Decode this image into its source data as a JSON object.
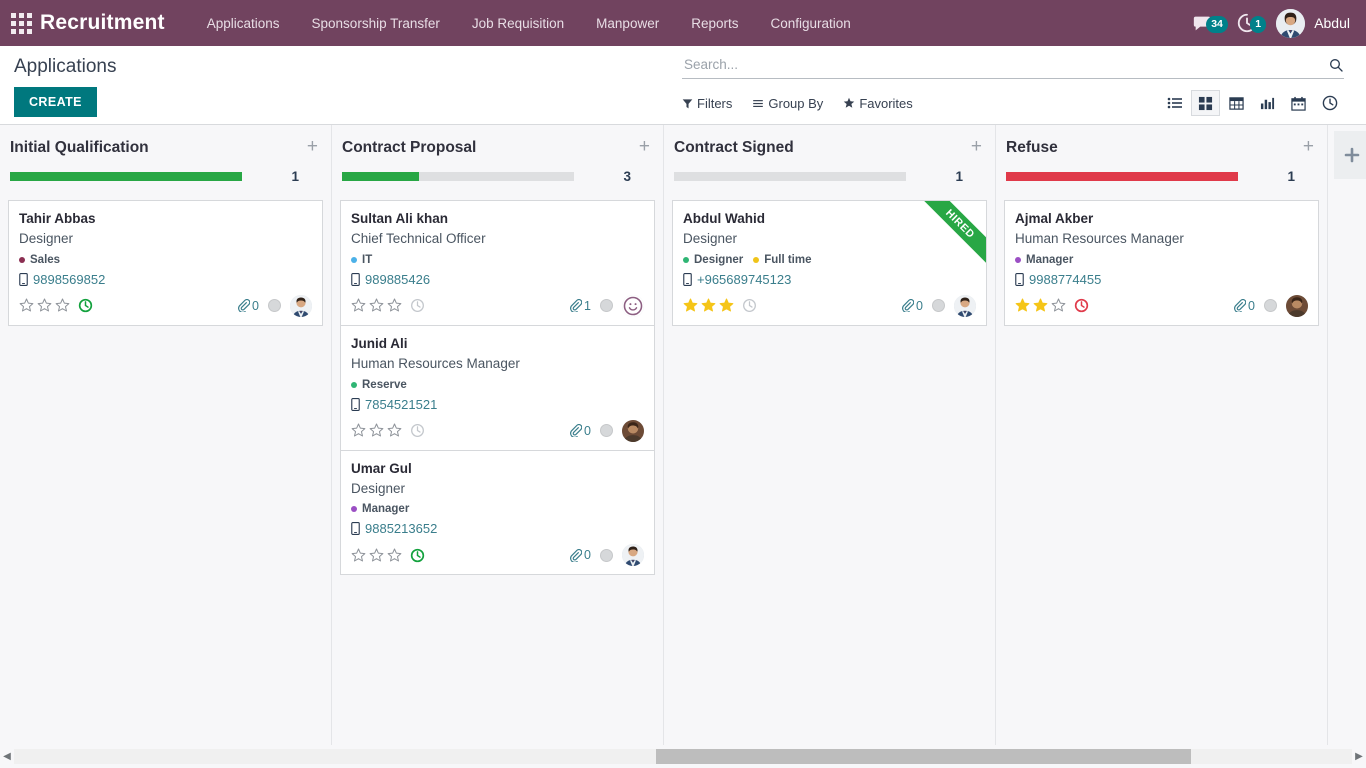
{
  "topbar": {
    "apps_icon": "apps-grid-icon",
    "brand": "Recruitment",
    "nav": [
      {
        "label": "Applications"
      },
      {
        "label": "Sponsorship Transfer"
      },
      {
        "label": "Job Requisition"
      },
      {
        "label": "Manpower"
      },
      {
        "label": "Reports"
      },
      {
        "label": "Configuration"
      }
    ],
    "messages_icon": "chat-bubble-icon",
    "messages_count": "34",
    "activity_icon": "clock-activity-icon",
    "activity_count": "1",
    "avatar_icon": "user-avatar",
    "user_name": "Abdul",
    "bar_color": "#71435f",
    "badge_color": "#00818a"
  },
  "control_panel": {
    "page_title": "Applications",
    "create_label": "CREATE",
    "create_color": "#00787e",
    "search": {
      "placeholder": "Search...",
      "value": "",
      "icon": "search-icon"
    },
    "filters": [
      {
        "label": "Filters",
        "icon": "funnel-icon"
      },
      {
        "label": "Group By",
        "icon": "bars-icon"
      },
      {
        "label": "Favorites",
        "icon": "star-icon"
      }
    ],
    "views": [
      {
        "name": "list-view",
        "icon": "list-icon",
        "active": false
      },
      {
        "name": "kanban-view",
        "icon": "kanban-icon",
        "active": true
      },
      {
        "name": "pivot-view",
        "icon": "table-icon",
        "active": false
      },
      {
        "name": "graph-view",
        "icon": "bar-chart-icon",
        "active": false
      },
      {
        "name": "calendar-view",
        "icon": "calendar-icon",
        "active": false
      },
      {
        "name": "activity-view",
        "icon": "clock-icon",
        "active": false
      }
    ]
  },
  "kanban": {
    "add_column_icon": "plus-icon",
    "columns": [
      {
        "title": "Initial Qualification",
        "count": "1",
        "progress_percent": 100,
        "progress_color": "#28a745",
        "add_icon": "plus-icon",
        "cards": [
          {
            "name": "Tahir Abbas",
            "job": "Designer",
            "tags": [
              {
                "label": "Sales",
                "color": "#8b2f52"
              }
            ],
            "phone": "9898569852",
            "stars": 0,
            "activity": "green",
            "attachments": "0",
            "avatar": "photo-man-blue"
          }
        ]
      },
      {
        "title": "Contract Proposal",
        "count": "3",
        "progress_percent": 33,
        "progress_color": "#28a745",
        "add_icon": "plus-icon",
        "cards": [
          {
            "name": "Sultan Ali khan",
            "job": "Chief Technical Officer",
            "tags": [
              {
                "label": "IT",
                "color": "#4cb1e8"
              }
            ],
            "phone": "989885426",
            "stars": 0,
            "activity": "none",
            "attachments": "1",
            "avatar": "smiley-face"
          },
          {
            "name": "Junid Ali",
            "job": "Human Resources Manager",
            "tags": [
              {
                "label": "Reserve",
                "color": "#2fb574"
              }
            ],
            "phone": "7854521521",
            "stars": 0,
            "activity": "none",
            "attachments": "0",
            "avatar": "photo-man-brown"
          },
          {
            "name": "Umar Gul",
            "job": "Designer",
            "tags": [
              {
                "label": "Manager",
                "color": "#9b4fc4"
              }
            ],
            "phone": "9885213652",
            "stars": 0,
            "activity": "green",
            "attachments": "0",
            "avatar": "photo-man-blue"
          }
        ]
      },
      {
        "title": "Contract Signed",
        "count": "1",
        "progress_percent": 0,
        "progress_color": "#28a745",
        "add_icon": "plus-icon",
        "cards": [
          {
            "name": "Abdul Wahid",
            "job": "Designer",
            "tags": [
              {
                "label": "Designer",
                "color": "#2fb574"
              },
              {
                "label": "Full time",
                "color": "#f0c419"
              }
            ],
            "phone": "+965689745123",
            "stars": 3,
            "activity": "none",
            "attachments": "0",
            "avatar": "photo-man-blue",
            "ribbon": "HIRED"
          }
        ]
      },
      {
        "title": "Refuse",
        "count": "1",
        "progress_percent": 100,
        "progress_color": "#e03a4a",
        "add_icon": "plus-icon",
        "cards": [
          {
            "name": "Ajmal Akber",
            "job": "Human Resources Manager",
            "tags": [
              {
                "label": "Manager",
                "color": "#9b4fc4"
              }
            ],
            "phone": "9988774455",
            "stars": 2,
            "activity": "red",
            "attachments": "0",
            "avatar": "photo-man-brown"
          }
        ]
      }
    ]
  },
  "scrollbar": {
    "left_arrow": "◀",
    "right_arrow": "▶"
  }
}
